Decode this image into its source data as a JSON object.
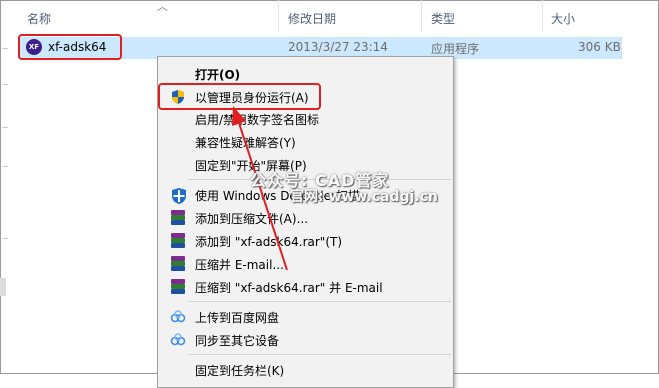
{
  "columns": {
    "name": "名称",
    "modified": "修改日期",
    "type": "类型",
    "size": "大小"
  },
  "file": {
    "icon_text": "XF",
    "name": "xf-adsk64",
    "modified": "2013/3/27 23:14",
    "type": "应用程序",
    "size": "306 KB"
  },
  "menu": {
    "open": "打开(O)",
    "run_as_admin": "以管理员身份运行(A)",
    "toggle_signature": "启用/禁用数字签名图标",
    "troubleshoot": "兼容性疑难解答(Y)",
    "pin_start": "固定到\"开始\"屏幕(P)",
    "defender_scan": "使用 Windows Defender扫描...",
    "add_archive": "添加到压缩文件(A)...",
    "add_rar": "添加到 \"xf-adsk64.rar\"(T)",
    "compress_email": "压缩并 E-mail...",
    "compress_rar_email": "压缩到 \"xf-adsk64.rar\" 并 E-mail",
    "upload_baidu": "上传到百度网盘",
    "sync_devices": "同步至其它设备",
    "pin_taskbar": "固定到任务栏(K)"
  },
  "watermark": {
    "line1": "公众号: CAD管家",
    "line2": "官网: www.cadgj.cn"
  },
  "colors": {
    "selection": "#cce8ff",
    "highlight_border": "#e02020",
    "header_text": "#4c607a"
  }
}
